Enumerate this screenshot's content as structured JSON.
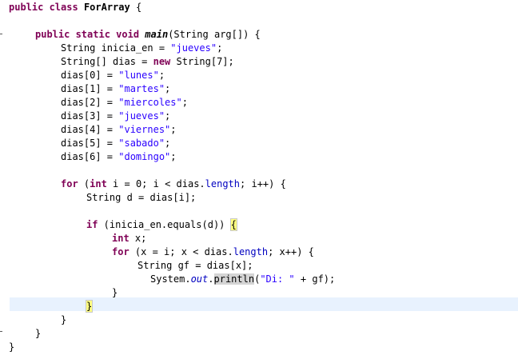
{
  "code": {
    "l1": {
      "kw": "public class",
      "name": "ForArray",
      "rest": " {"
    },
    "l2": {
      "kw": "public static void",
      "method": "main",
      "rest": "(String arg[]) {"
    },
    "l3": {
      "a": "String inicia_en = ",
      "s": "\"jueves\"",
      "b": ";"
    },
    "l4": {
      "a": "String[] dias = ",
      "kw": "new",
      "b": " String[7];"
    },
    "l5": {
      "a": "dias[0] = ",
      "s": "\"lunes\"",
      "b": ";"
    },
    "l6": {
      "a": "dias[1] = ",
      "s": "\"martes\"",
      "b": ";"
    },
    "l7": {
      "a": "dias[2] = ",
      "s": "\"miercoles\"",
      "b": ";"
    },
    "l8": {
      "a": "dias[3] = ",
      "s": "\"jueves\"",
      "b": ";"
    },
    "l9": {
      "a": "dias[4] = ",
      "s": "\"viernes\"",
      "b": ";"
    },
    "l10": {
      "a": "dias[5] = ",
      "s": "\"sabado\"",
      "b": ";"
    },
    "l11": {
      "a": "dias[6] = ",
      "s": "\"domingo\"",
      "b": ";"
    },
    "l12": {
      "kw": "for",
      "a": " (",
      "kw2": "int",
      "b": " i = 0; i < dias.",
      "fld": "length",
      "c": "; i++) {"
    },
    "l13": {
      "a": "String d = dias[i];"
    },
    "l14": {
      "kw": "if",
      "a": " (inicia_en.equals(d)) ",
      "brace": "{"
    },
    "l15": {
      "kw": "int",
      "a": " x;"
    },
    "l16": {
      "kw": "for",
      "a": " (x = i; x < dias.",
      "fld": "length",
      "b": "; x++) {"
    },
    "l17": {
      "a": "String gf = dias[x];"
    },
    "l18": {
      "a": "System.",
      "sfld": "out",
      "b": ".",
      "mth": "println",
      "c": "(",
      "s": "\"Di: \"",
      "d": " + gf);"
    },
    "l19": {
      "a": "}"
    },
    "l20": {
      "brace": "}"
    },
    "l21": {
      "a": "}"
    },
    "l22": {
      "a": "}"
    },
    "l23": {
      "a": "}"
    }
  }
}
